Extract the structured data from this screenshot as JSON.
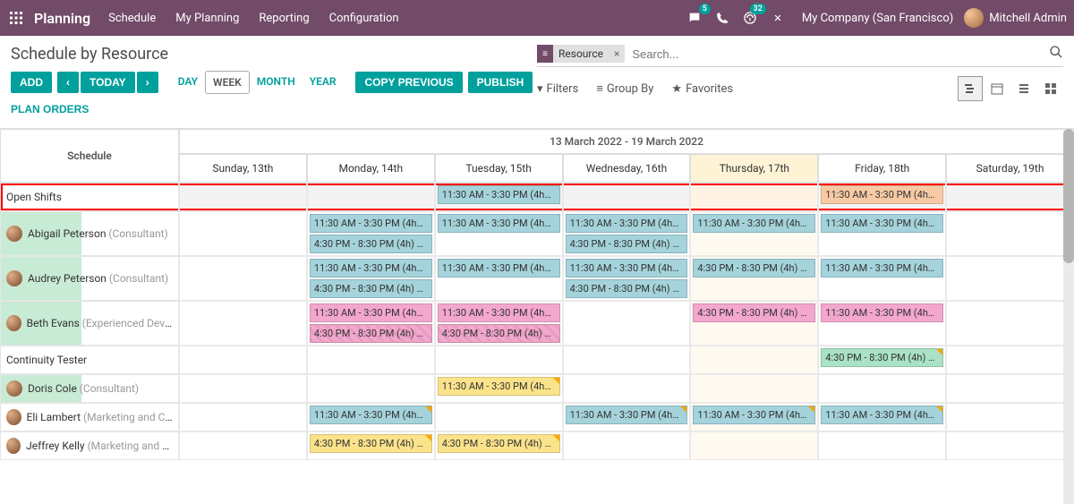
{
  "topnav": {
    "brand": "Planning",
    "menu": [
      "Schedule",
      "My Planning",
      "Reporting",
      "Configuration"
    ],
    "messaging_badge": "5",
    "activities_badge": "32",
    "company": "My Company (San Francisco)",
    "user": "Mitchell Admin"
  },
  "control": {
    "title": "Schedule by Resource",
    "btn_add": "ADD",
    "btn_today": "TODAY",
    "btn_plan": "PLAN ORDERS",
    "scales": {
      "day": "DAY",
      "week": "WEEK",
      "month": "MONTH",
      "year": "YEAR"
    },
    "btn_copy": "COPY PREVIOUS",
    "btn_publish": "PUBLISH"
  },
  "search": {
    "group_label": "Resource",
    "placeholder": "Search...",
    "filters": "Filters",
    "groupby": "Group By",
    "favorites": "Favorites"
  },
  "grid": {
    "schedule_label": "Schedule",
    "range": "13 March 2022 - 19 March 2022",
    "today_index": 4,
    "days": [
      "Sunday, 13th",
      "Monday, 14th",
      "Tuesday, 15th",
      "Wednesday, 16th",
      "Thursday, 17th",
      "Friday, 18th",
      "Saturday, 19th"
    ],
    "rows": [
      {
        "name": "Open Shifts",
        "role": "",
        "avatar": false,
        "highlight": true,
        "barclass": "",
        "cells": [
          [],
          [],
          [
            {
              "t": "11:30 AM - 3:30 PM (4h…",
              "c": "c-blue"
            }
          ],
          [],
          [],
          [
            {
              "t": "11:30 AM - 3:30 PM (4h…",
              "c": "c-orange"
            }
          ],
          []
        ]
      },
      {
        "name": "Abigail Peterson",
        "role": "(Consultant)",
        "avatar": true,
        "barclass": "half",
        "cells": [
          [],
          [
            {
              "t": "11:30 AM - 3:30 PM (4h…",
              "c": "c-blue"
            },
            {
              "t": "4:30 PM - 8:30 PM (4h) …",
              "c": "c-blue"
            }
          ],
          [
            {
              "t": "11:30 AM - 3:30 PM (4h…",
              "c": "c-blue"
            }
          ],
          [
            {
              "t": "11:30 AM - 3:30 PM (4h…",
              "c": "c-blue"
            },
            {
              "t": "4:30 PM - 8:30 PM (4h) …",
              "c": "c-blue"
            }
          ],
          [
            {
              "t": "11:30 AM - 3:30 PM (4h…",
              "c": "c-blue"
            }
          ],
          [
            {
              "t": "11:30 AM - 3:30 PM (4h…",
              "c": "c-blue"
            }
          ],
          []
        ]
      },
      {
        "name": "Audrey Peterson",
        "role": "(Consultant)",
        "avatar": true,
        "barclass": "half",
        "cells": [
          [],
          [
            {
              "t": "11:30 AM - 3:30 PM (4h…",
              "c": "c-blue"
            },
            {
              "t": "4:30 PM - 8:30 PM (4h) …",
              "c": "c-blue"
            }
          ],
          [
            {
              "t": "11:30 AM - 3:30 PM (4h…",
              "c": "c-blue"
            }
          ],
          [
            {
              "t": "11:30 AM - 3:30 PM (4h…",
              "c": "c-blue"
            },
            {
              "t": "4:30 PM - 8:30 PM (4h) …",
              "c": "c-blue"
            }
          ],
          [
            {
              "t": "4:30 PM - 8:30 PM (4h) …",
              "c": "c-blue"
            }
          ],
          [
            {
              "t": "11:30 AM - 3:30 PM (4h…",
              "c": "c-blue"
            }
          ],
          []
        ]
      },
      {
        "name": "Beth Evans",
        "role": "(Experienced Develo…",
        "avatar": true,
        "barclass": "half",
        "cells": [
          [],
          [
            {
              "t": "11:30 AM - 3:30 PM (4h…",
              "c": "c-pink"
            },
            {
              "t": "4:30 PM - 8:30 PM (4h) …",
              "c": "c-pink hatch"
            }
          ],
          [
            {
              "t": "11:30 AM - 3:30 PM (4h…",
              "c": "c-pink"
            },
            {
              "t": "4:30 PM - 8:30 PM (4h) …",
              "c": "c-pink hatch"
            }
          ],
          [],
          [
            {
              "t": "4:30 PM - 8:30 PM (4h) …",
              "c": "c-pink"
            }
          ],
          [
            {
              "t": "11:30 AM - 3:30 PM (4h…",
              "c": "c-pink"
            }
          ],
          []
        ]
      },
      {
        "name": "Continuity Tester",
        "role": "",
        "avatar": false,
        "barclass": "",
        "cells": [
          [],
          [],
          [],
          [],
          [],
          [
            {
              "t": "4:30 PM - 8:30 PM (4h) …",
              "c": "c-green",
              "corner": true
            }
          ],
          []
        ]
      },
      {
        "name": "Doris Cole",
        "role": "(Consultant)",
        "avatar": true,
        "barclass": "half",
        "cells": [
          [],
          [],
          [
            {
              "t": "11:30 AM - 3:30 PM (4h…",
              "c": "c-yellow",
              "corner": true
            }
          ],
          [],
          [],
          [],
          []
        ]
      },
      {
        "name": "Eli Lambert",
        "role": "(Marketing and Com…",
        "avatar": true,
        "barclass": "",
        "cells": [
          [],
          [
            {
              "t": "11:30 AM - 3:30 PM (4h…",
              "c": "c-blue",
              "corner": true
            }
          ],
          [],
          [
            {
              "t": "11:30 AM - 3:30 PM (4h…",
              "c": "c-blue",
              "corner": true
            }
          ],
          [
            {
              "t": "11:30 AM - 3:30 PM (4h…",
              "c": "c-blue",
              "corner": true
            }
          ],
          [
            {
              "t": "11:30 AM - 3:30 PM (4h…",
              "c": "c-blue",
              "corner": true
            }
          ],
          []
        ]
      },
      {
        "name": "Jeffrey Kelly",
        "role": "(Marketing and Com…",
        "avatar": true,
        "barclass": "",
        "cells": [
          [],
          [
            {
              "t": "4:30 PM - 8:30 PM (4h) …",
              "c": "c-yellow",
              "corner": true
            }
          ],
          [
            {
              "t": "4:30 PM - 8:30 PM (4h) …",
              "c": "c-yellow",
              "corner": true
            }
          ],
          [],
          [],
          [],
          []
        ]
      }
    ]
  }
}
